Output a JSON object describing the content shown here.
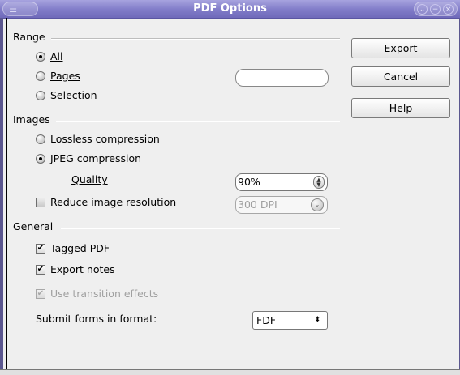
{
  "window": {
    "title": "PDF Options",
    "menu_glyph": "☰",
    "buttons": [
      "⌄",
      "−",
      "×"
    ]
  },
  "range": {
    "label": "Range",
    "options": [
      {
        "label": "All",
        "mnemonic_index": 0,
        "checked": true
      },
      {
        "label": "Pages",
        "mnemonic_index": 0,
        "checked": false
      },
      {
        "label": "Selection",
        "mnemonic_index": 0,
        "checked": false
      }
    ],
    "pages_value": ""
  },
  "images": {
    "label": "Images",
    "options": [
      {
        "label": "Lossless compression",
        "checked": false
      },
      {
        "label": "JPEG compression",
        "checked": true
      }
    ],
    "quality_label": "Quality",
    "quality_value": "90%",
    "reduce_label": "Reduce image resolution",
    "reduce_checked": false,
    "resolution_value": "300 DPI"
  },
  "general": {
    "label": "General",
    "tagged_pdf_label": "Tagged PDF",
    "tagged_pdf_checked": true,
    "export_notes_label": "Export notes",
    "export_notes_checked": true,
    "transition_label": "Use transition effects",
    "transition_checked": true,
    "submit_label": "Submit forms in format:",
    "submit_value": "FDF"
  },
  "buttons": {
    "export": "Export",
    "cancel": "Cancel",
    "help": "Help"
  },
  "icons": {
    "spin_up": "▲",
    "spin_down": "▼",
    "dropdown": "⌄",
    "select_arrows": "⬍",
    "check": "✔"
  }
}
